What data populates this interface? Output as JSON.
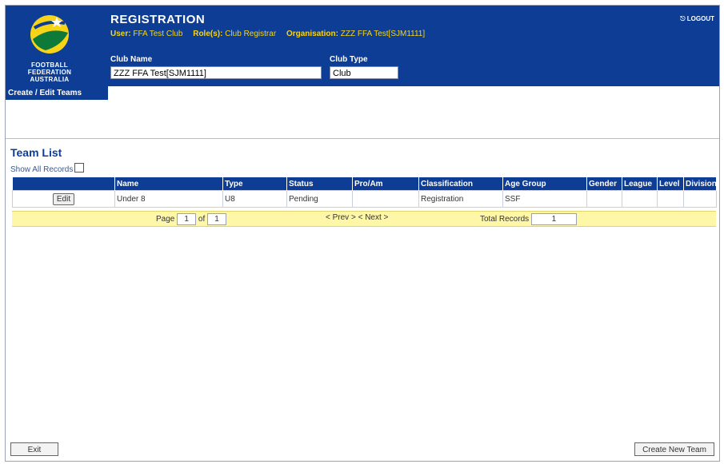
{
  "header": {
    "title": "REGISTRATION",
    "user_label": "User:",
    "user_value": "FFA Test Club",
    "role_label": "Role(s):",
    "role_value": "Club Registrar",
    "org_label": "Organisation:",
    "org_value": "ZZZ FFA Test[SJM1111]",
    "logout": "LOGOUT",
    "logo_line1": "FOOTBALL",
    "logo_line2": "FEDERATION",
    "logo_line3": "AUSTRALIA"
  },
  "fields": {
    "club_name_label": "Club Name",
    "club_name_value": "ZZZ FFA Test[SJM1111]",
    "club_type_label": "Club Type",
    "club_type_value": "Club"
  },
  "tabs": {
    "active": "Create / Edit Teams"
  },
  "team_list": {
    "title": "Team List",
    "show_all_label": "Show All Records",
    "columns": [
      "",
      "Name",
      "Type",
      "Status",
      "Pro/Am",
      "Classification",
      "Age Group",
      "Gender",
      "League",
      "Level",
      "Division"
    ],
    "rows": [
      {
        "action": "Edit",
        "name": "Under 8",
        "type": "U8",
        "status": "Pending",
        "proam": "",
        "classification": "Registration",
        "age_group": "SSF",
        "gender": "",
        "league": "",
        "level": "",
        "division": ""
      }
    ]
  },
  "pager": {
    "page_label": "Page",
    "page_value": "1",
    "of_label": "of",
    "of_value": "1",
    "nav": "< Prev > < Next >",
    "total_label": "Total Records",
    "total_value": "1"
  },
  "footer": {
    "exit": "Exit",
    "create": "Create New Team"
  },
  "colors": {
    "brand_blue": "#0d3d95",
    "gold": "#f7d417",
    "pager_bg": "#fff7a8"
  }
}
